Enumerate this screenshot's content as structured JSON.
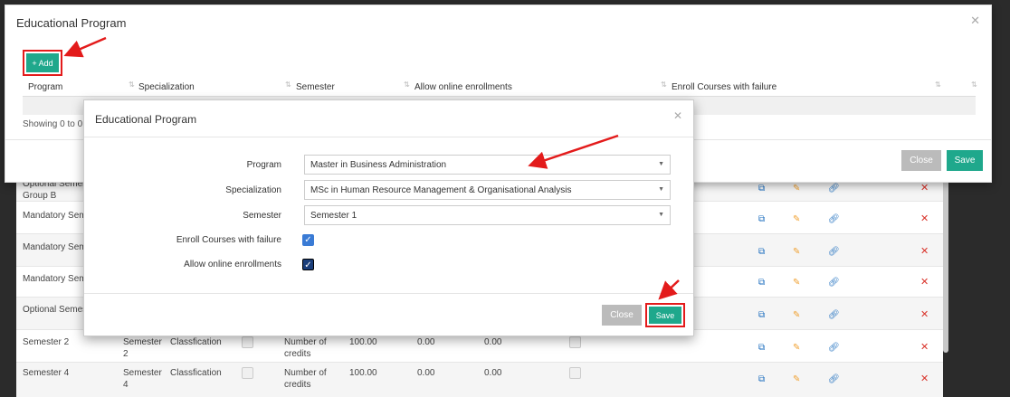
{
  "outer_modal": {
    "title": "Educational Program",
    "add_label": "+ Add",
    "columns": [
      "Program",
      "Specialization",
      "Semester",
      "Allow online enrollments",
      "Enroll Courses with failure"
    ],
    "showing": "Showing 0 to 0 o",
    "close_label": "Close",
    "save_label": "Save"
  },
  "inner_modal": {
    "title": "Educational Program",
    "fields": {
      "program_label": "Program",
      "program_value": "Master in Business Administration",
      "specialization_label": "Specialization",
      "specialization_value": "MSc in Human Resource Management & Organisational Analysis",
      "semester_label": "Semester",
      "semester_value": "Semester 1",
      "enroll_label": "Enroll Courses with failure",
      "enroll_checked": true,
      "online_label": "Allow online enrollments",
      "online_checked": true
    },
    "close_label": "Close",
    "save_label": "Save"
  },
  "background_rows": [
    {
      "col1": "Optional Semes",
      "col1b": "Group B"
    },
    {
      "col1": "Mandatory Seme"
    },
    {
      "col1": "Mandatory Sem"
    },
    {
      "col1": "Mandatory Sem"
    },
    {
      "col1": "Optional Semes"
    },
    {
      "col1": "Semester 2",
      "sem": "Semester",
      "sem_b": "2",
      "type": "Classfication",
      "unit": "Number of",
      "unit_b": "credits",
      "v1": "100.00",
      "v2": "0.00",
      "v3": "0.00"
    },
    {
      "col1": "Semester 4",
      "sem": "Semester",
      "sem_b": "4",
      "type": "Classfication",
      "unit": "Number of",
      "unit_b": "credits",
      "v1": "100.00",
      "v2": "0.00",
      "v3": "0.00"
    }
  ],
  "icons": {
    "copy": "copy-icon",
    "edit": "pencil-icon",
    "link": "link-icon",
    "delete": "x-icon",
    "close": "close-icon",
    "caret": "caret-down-icon",
    "sort": "sort-icon"
  },
  "colors": {
    "accent": "#1fa88c",
    "highlight": "#e31b1b",
    "check": "#3a7bd5"
  }
}
